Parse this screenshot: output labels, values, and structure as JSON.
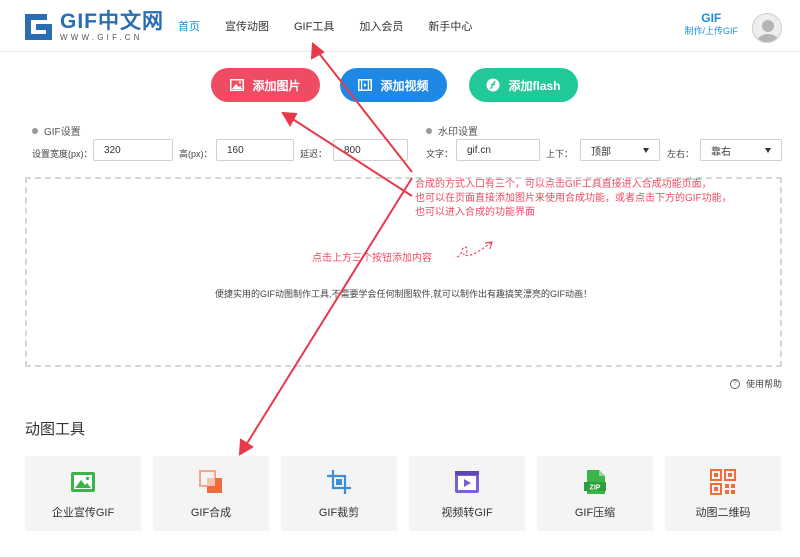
{
  "header": {
    "logo_title": "GIF中文网",
    "logo_sub": "WWW.GIF.CN",
    "nav": [
      {
        "label": "首页",
        "active": true
      },
      {
        "label": "宣传动图",
        "active": false
      },
      {
        "label": "GIF工具",
        "active": false
      },
      {
        "label": "加入会员",
        "active": false
      },
      {
        "label": "新手中心",
        "active": false
      }
    ],
    "upload_title": "GIF",
    "upload_sub": "制作/上传GIF",
    "avatar_icon": "user-avatar-icon"
  },
  "actions": {
    "add_image": "添加图片",
    "add_video": "添加视频",
    "add_flash": "添加flash",
    "colors": {
      "image": "#ef4b63",
      "video": "#1e88e5",
      "flash": "#20c997"
    }
  },
  "gif_settings": {
    "title": "GIF设置",
    "width_label": "设置宽度(px)：",
    "width_value": "320",
    "height_label": "高(px)：",
    "height_value": "160",
    "delay_label": "延迟：",
    "delay_value": "800"
  },
  "watermark": {
    "title": "水印设置",
    "text_label": "文字：",
    "text_value": "gif.cn",
    "vertical_label": "上下：",
    "vertical_value": "顶部",
    "horizontal_label": "左右：",
    "horizontal_value": "靠右"
  },
  "dropzone": {
    "hint": "点击上方三个按钮添加内容",
    "description": "便捷实用的GIF动图制作工具,不需要学会任何制图软件,就可以制作出有趣搞笑漂亮的GIF动画！"
  },
  "annotation": {
    "line1": "合成的方式入口有三个，可以点击GIF工具直接进入合成功能页面，",
    "line2": "也可以在页面直接添加图片来使用合成功能，或者点击下方的GIF功能，",
    "line3": "也可以进入合成的功能界面",
    "color": "#ef4b63"
  },
  "help": {
    "label": "使用帮助"
  },
  "tools": {
    "title": "动图工具",
    "items": [
      {
        "label": "企业宣传GIF",
        "icon": "image-icon"
      },
      {
        "label": "GIF合成",
        "icon": "merge-icon"
      },
      {
        "label": "GIF裁剪",
        "icon": "crop-icon"
      },
      {
        "label": "视频转GIF",
        "icon": "video-icon"
      },
      {
        "label": "GIF压缩",
        "icon": "zip-icon"
      },
      {
        "label": "动图二维码",
        "icon": "qrcode-icon"
      }
    ]
  }
}
